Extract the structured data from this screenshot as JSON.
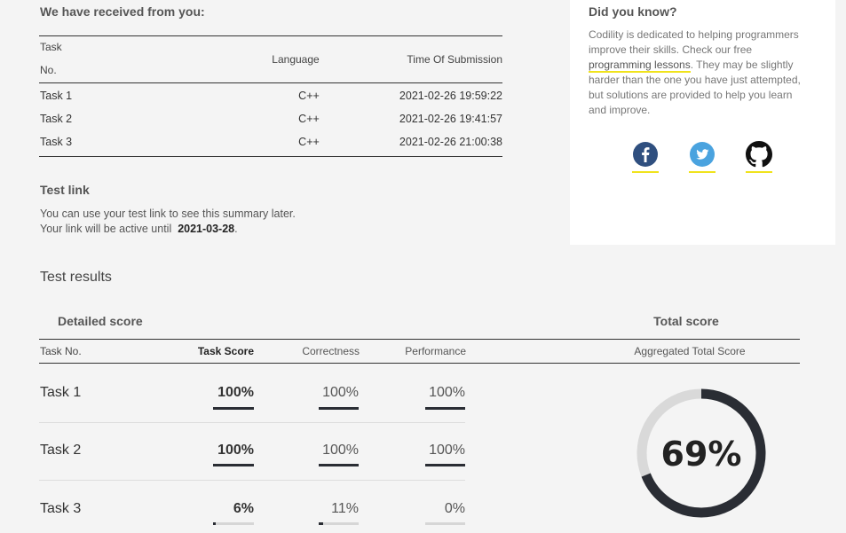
{
  "received": {
    "heading": "We have received from you:",
    "columns": {
      "task_line1": "Task",
      "task_line2": "No.",
      "language": "Language",
      "time": "Time Of Submission"
    },
    "rows": [
      {
        "task": "Task 1",
        "language": "C++",
        "time": "2021-02-26 19:59:22"
      },
      {
        "task": "Task 2",
        "language": "C++",
        "time": "2021-02-26 19:41:57"
      },
      {
        "task": "Task 3",
        "language": "C++",
        "time": "2021-02-26 21:00:38"
      }
    ]
  },
  "test_link": {
    "heading": "Test link",
    "line1": "You can use your test link to see this summary later.",
    "line2_prefix": "Your link will be active until",
    "date": "2021-03-28",
    "line2_suffix": "."
  },
  "did_you_know": {
    "heading": "Did you know?",
    "text_before": "Codility is dedicated to helping programmers improve their skills. Check our free ",
    "link": "programming lessons",
    "text_after": ". They may be slightly harder than the one you have just attempted, but solutions are provided to help you learn and improve.",
    "social": [
      "facebook-icon",
      "twitter-icon",
      "github-icon"
    ]
  },
  "results": {
    "title": "Test results",
    "detailed_heading": "Detailed score",
    "total_heading": "Total score",
    "columns": {
      "task": "Task No.",
      "task_score": "Task Score",
      "correctness": "Correctness",
      "performance": "Performance",
      "aggregated": "Aggregated Total Score"
    },
    "rows": [
      {
        "task": "Task 1",
        "task_score": "100%",
        "correctness": "100%",
        "performance": "100%",
        "task_score_pct": 100,
        "correctness_pct": 100,
        "performance_pct": 100
      },
      {
        "task": "Task 2",
        "task_score": "100%",
        "correctness": "100%",
        "performance": "100%",
        "task_score_pct": 100,
        "correctness_pct": 100,
        "performance_pct": 100
      },
      {
        "task": "Task 3",
        "task_score": "6%",
        "correctness": "11%",
        "performance": "0%",
        "task_score_pct": 6,
        "correctness_pct": 11,
        "performance_pct": 0
      }
    ],
    "total": "69%",
    "total_pct": 69
  },
  "colors": {
    "accent": "#f0e31c",
    "dark": "#2a2d34",
    "track": "#d6d6d6",
    "facebook": "#2f4f7f",
    "twitter": "#4aa3df"
  }
}
